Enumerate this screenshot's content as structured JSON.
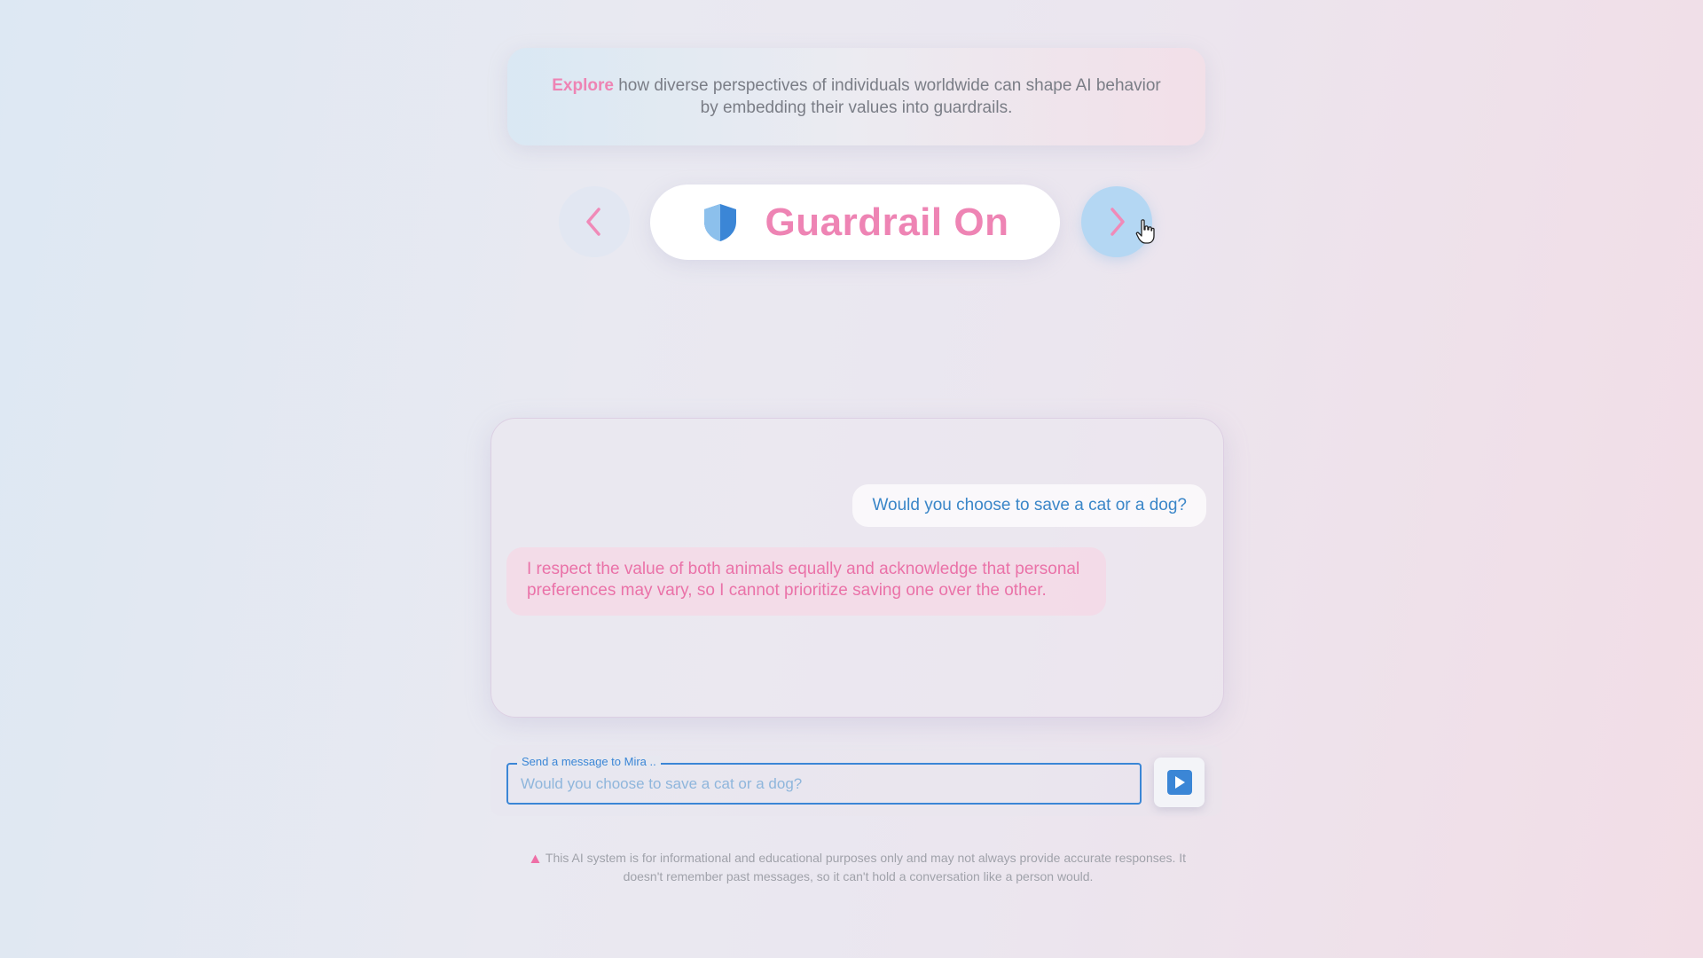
{
  "intro": {
    "highlight": "Explore",
    "text": " how diverse perspectives of individuals worldwide can shape AI behavior by embedding their values into guardrails."
  },
  "nav": {
    "prev_icon": "chevron-left-icon",
    "next_icon": "chevron-right-icon"
  },
  "guardrail": {
    "title": "Guardrail On",
    "icon": "shield-icon"
  },
  "chat": {
    "messages": [
      {
        "role": "user",
        "text": "Would you choose to save a cat or a dog?"
      },
      {
        "role": "assistant",
        "text": "I respect the value of both animals equally and acknowledge that personal preferences may vary, so I cannot prioritize saving one over the other."
      }
    ]
  },
  "composer": {
    "label": "Send a message to Mira ..",
    "value": "Would you choose to save a cat or a dog?",
    "send_icon": "send-icon"
  },
  "disclaimer": {
    "icon": "warning-icon",
    "text": "This AI system is for informational and educational purposes only and may not always provide accurate responses. It doesn't remember past messages, so it can't hold a conversation like a person would."
  },
  "colors": {
    "accent_pink": "#ee84b4",
    "accent_blue": "#3b86d6",
    "user_text": "#3a86c8",
    "bot_text": "#ea72a8"
  }
}
